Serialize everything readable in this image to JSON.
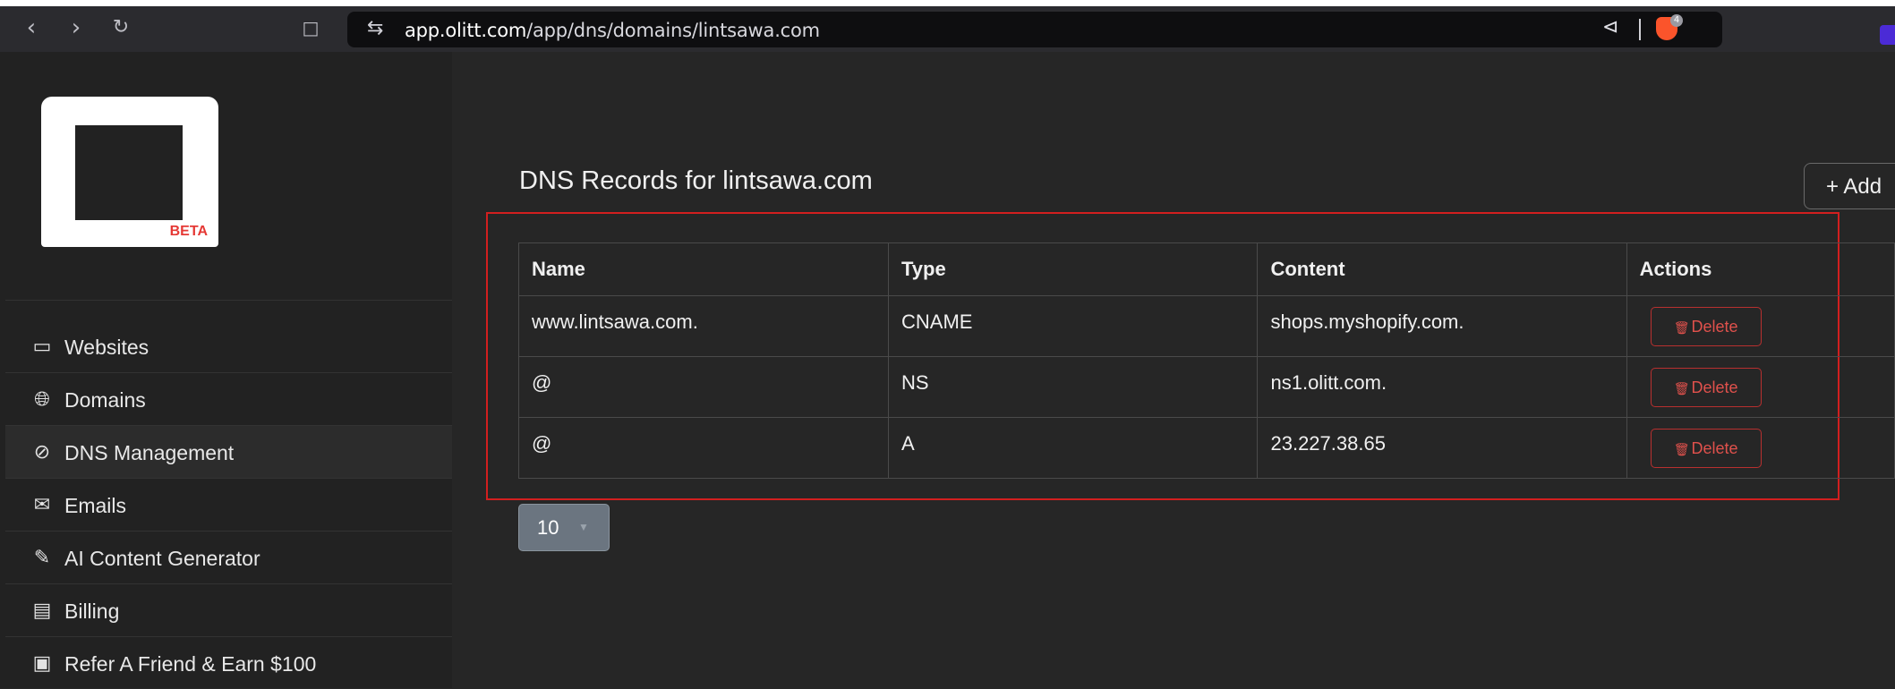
{
  "browser": {
    "url_host": "app.olitt.com",
    "url_path": "/app/dns/domains/lintsawa.com",
    "shields_count": "4"
  },
  "sidebar": {
    "logo_badge": "BETA",
    "items": [
      {
        "label": "Websites",
        "icon": "browser-window-icon"
      },
      {
        "label": "Domains",
        "icon": "globe-icon"
      },
      {
        "label": "DNS Management",
        "icon": "compass-icon"
      },
      {
        "label": "Emails",
        "icon": "envelope-icon"
      },
      {
        "label": "AI Content Generator",
        "icon": "pen-icon"
      },
      {
        "label": "Billing",
        "icon": "receipt-icon"
      },
      {
        "label": "Refer A Friend & Earn $100",
        "icon": "ticket-icon"
      }
    ]
  },
  "main": {
    "title": "DNS Records for lintsawa.com",
    "add_button": "+ Add",
    "table": {
      "headers": [
        "Name",
        "Type",
        "Content",
        "Actions"
      ],
      "rows": [
        {
          "name": "www.lintsawa.com.",
          "type": "CNAME",
          "content": "shops.myshopify.com.",
          "action": "Delete"
        },
        {
          "name": "@",
          "type": "NS",
          "content": "ns1.olitt.com.",
          "action": "Delete"
        },
        {
          "name": "@",
          "type": "A",
          "content": "23.227.38.65",
          "action": "Delete"
        }
      ]
    },
    "page_size": "10"
  },
  "colors": {
    "accent_red": "#d21f1f",
    "delete_red": "#e0514c",
    "background": "#262626"
  }
}
